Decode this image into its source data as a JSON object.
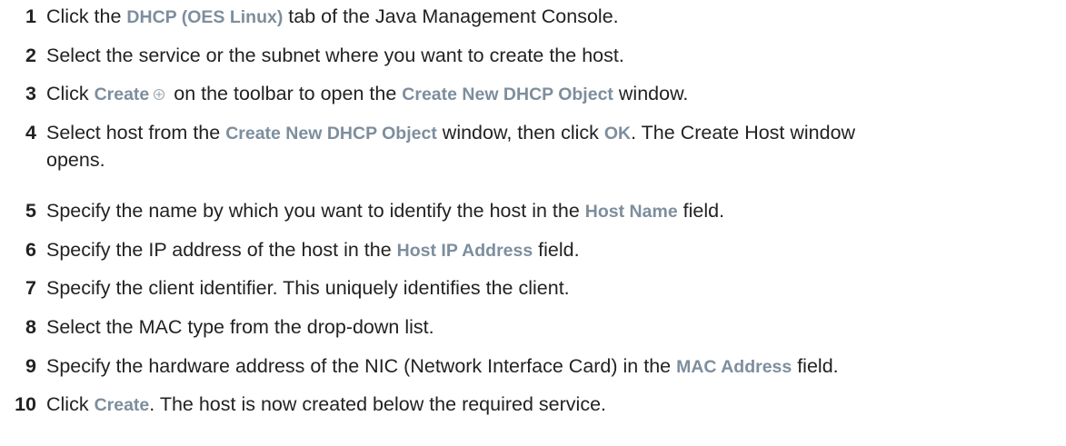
{
  "steps": [
    {
      "num": "1",
      "parts": [
        {
          "t": "Click the "
        },
        {
          "ui": "DHCP (OES Linux)"
        },
        {
          "t": " tab of the Java Management Console."
        }
      ]
    },
    {
      "num": "2",
      "parts": [
        {
          "t": "Select the service or the subnet where you want to create the host."
        }
      ]
    },
    {
      "num": "3",
      "parts": [
        {
          "t": "Click "
        },
        {
          "ui": "Create"
        },
        {
          "icon": "create-icon"
        },
        {
          "t": " on the toolbar to open the "
        },
        {
          "ui": "Create New DHCP Object"
        },
        {
          "t": " window."
        }
      ]
    },
    {
      "num": "4",
      "parts": [
        {
          "t": "Select host from the "
        },
        {
          "ui": "Create New DHCP Object"
        },
        {
          "t": " window, then click "
        },
        {
          "ui": "OK"
        },
        {
          "t": ". The Create Host window"
        }
      ],
      "continuation": "opens."
    },
    {
      "num": "5",
      "parts": [
        {
          "t": "Specify the name by which you want to identify the host in the "
        },
        {
          "ui": "Host Name"
        },
        {
          "t": " field."
        }
      ]
    },
    {
      "num": "6",
      "parts": [
        {
          "t": "Specify the IP address of the host in the "
        },
        {
          "ui": "Host IP Address"
        },
        {
          "t": " field."
        }
      ]
    },
    {
      "num": "7",
      "parts": [
        {
          "t": "Specify the client identifier. This uniquely identifies the client."
        }
      ]
    },
    {
      "num": "8",
      "parts": [
        {
          "t": "Select the MAC type from the drop-down list."
        }
      ]
    },
    {
      "num": "9",
      "parts": [
        {
          "t": "Specify the hardware address of the NIC (Network Interface Card) in the "
        },
        {
          "ui": "MAC Address"
        },
        {
          "t": " field."
        }
      ]
    },
    {
      "num": "10",
      "parts": [
        {
          "t": "Click "
        },
        {
          "ui": "Create"
        },
        {
          "t": ". The host is now created below the required service."
        }
      ]
    }
  ],
  "colors": {
    "text": "#222222",
    "ui_term": "#7d8e9d"
  }
}
